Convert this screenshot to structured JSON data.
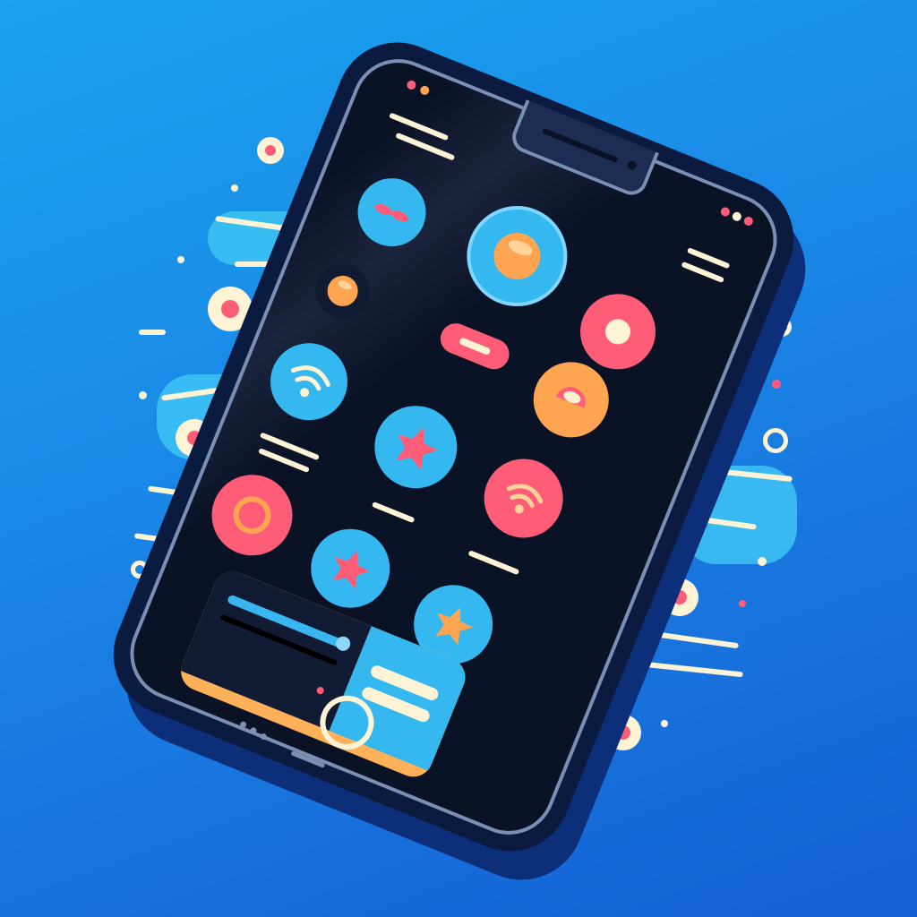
{
  "colors": {
    "background": "#1a86e6",
    "phone_body": "#0b1a3f",
    "screen": "#0a1226",
    "accent_blue": "#35b7ef",
    "accent_red": "#ff5c77",
    "accent_orange": "#ffa552",
    "cream": "#fff3d6"
  },
  "screen_icons": [
    {
      "name": "mustache-icon",
      "color": "#35b7ef"
    },
    {
      "name": "orb-icon",
      "color": "#35b7ef"
    },
    {
      "name": "record-icon",
      "color": "#ff5c77"
    },
    {
      "name": "orb-small-icon",
      "color": "#0a1226"
    },
    {
      "name": "pill-button-icon",
      "color": "#ff5c77"
    },
    {
      "name": "orb-orange-icon",
      "color": "#ffa552"
    },
    {
      "name": "wifi-icon",
      "color": "#35b7ef"
    },
    {
      "name": "star-icon",
      "color": "#35b7ef"
    },
    {
      "name": "wifi-red-icon",
      "color": "#ff5c77"
    },
    {
      "name": "ring-icon",
      "color": "#ff5c77"
    },
    {
      "name": "star-blue-icon",
      "color": "#35b7ef"
    },
    {
      "name": "star-orange-icon",
      "color": "#35b7ef"
    }
  ]
}
